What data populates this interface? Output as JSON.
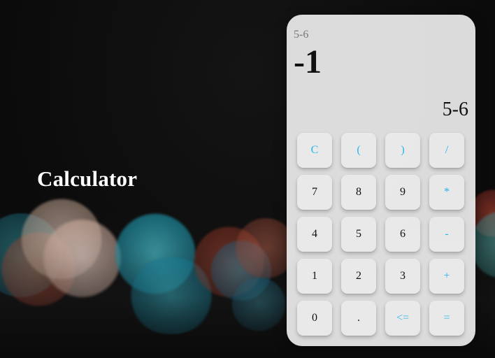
{
  "page": {
    "title": "Calculator"
  },
  "calculator": {
    "expression_top": "5-6",
    "result": "-1",
    "expression_input": "5-6",
    "keys": [
      {
        "label": "C",
        "type": "op"
      },
      {
        "label": "(",
        "type": "op"
      },
      {
        "label": ")",
        "type": "op"
      },
      {
        "label": "/",
        "type": "op"
      },
      {
        "label": "7",
        "type": "num"
      },
      {
        "label": "8",
        "type": "num"
      },
      {
        "label": "9",
        "type": "num"
      },
      {
        "label": "*",
        "type": "op"
      },
      {
        "label": "4",
        "type": "num"
      },
      {
        "label": "5",
        "type": "num"
      },
      {
        "label": "6",
        "type": "num"
      },
      {
        "label": "-",
        "type": "op"
      },
      {
        "label": "1",
        "type": "num"
      },
      {
        "label": "2",
        "type": "num"
      },
      {
        "label": "3",
        "type": "num"
      },
      {
        "label": "+",
        "type": "op"
      },
      {
        "label": "0",
        "type": "num"
      },
      {
        "label": ".",
        "type": "num"
      },
      {
        "label": "<=",
        "type": "op"
      },
      {
        "label": "=",
        "type": "op"
      }
    ]
  },
  "colors": {
    "operator_text": "#29b6e6",
    "number_text": "#111111",
    "panel_background": "#ececec",
    "page_background": "#0d0d0d"
  }
}
